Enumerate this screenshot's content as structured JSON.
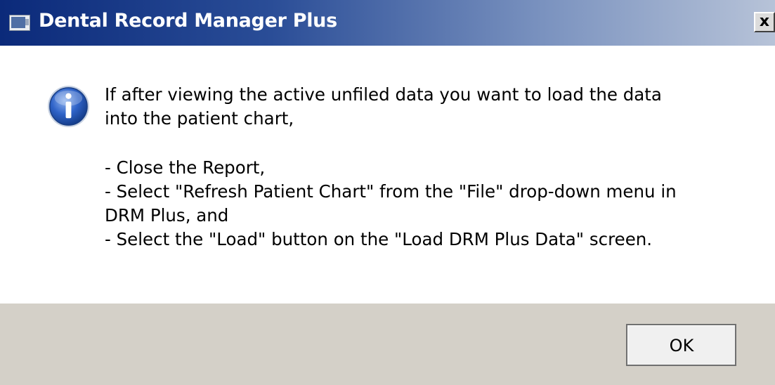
{
  "window": {
    "title": "Dental Record Manager Plus",
    "close_label": "x"
  },
  "dialog": {
    "icon": "info-icon",
    "message_lines": [
      "If after viewing the active unfiled data you want to load the data",
      "into the patient chart,",
      "- Close the Report,",
      "- Select \"Refresh Patient Chart\" from the \"File\" drop-down menu in",
      "DRM Plus, and",
      "- Select the \"Load\" button on the \"Load DRM Plus Data\" screen."
    ]
  },
  "buttons": {
    "ok_label": "OK"
  },
  "colors": {
    "titlebar_start": "#0b2a7a",
    "titlebar_end": "#b7c3d8",
    "footer": "#d4d0c8",
    "content": "#ffffff"
  }
}
